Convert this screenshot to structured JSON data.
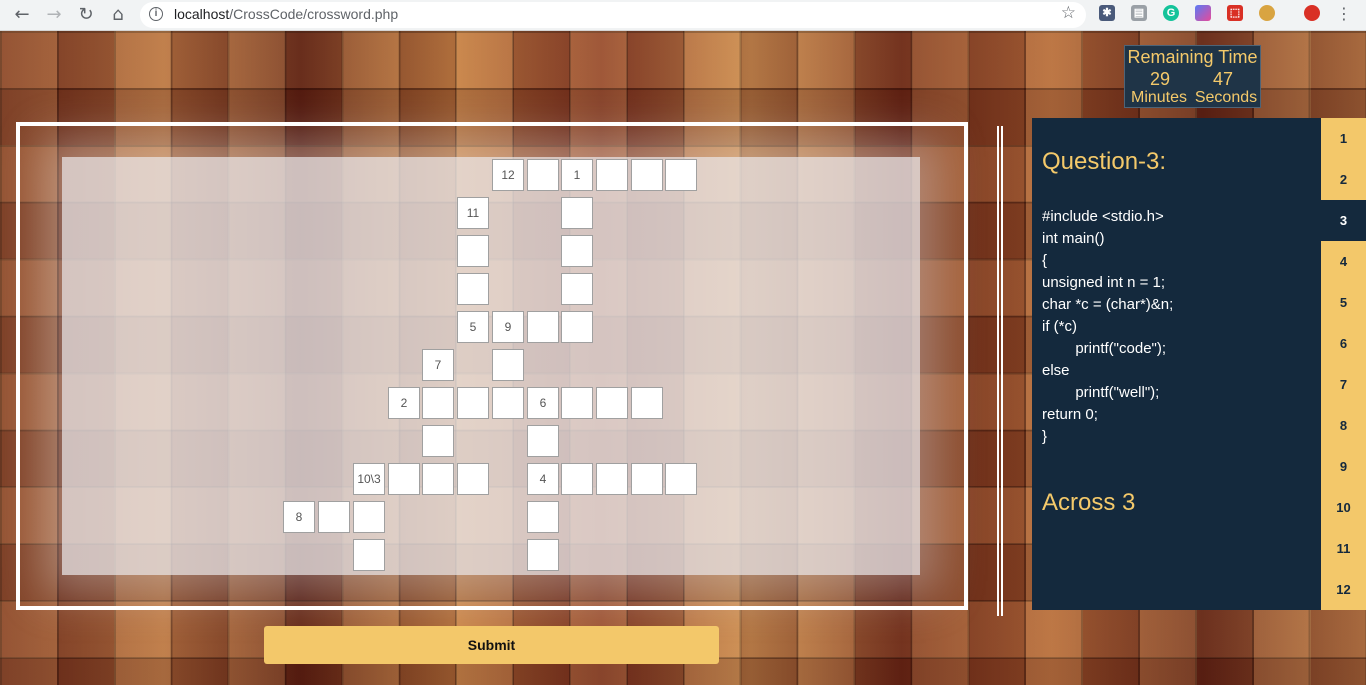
{
  "browser": {
    "url_host": "localhost",
    "url_path": "/CrossCode/crossword.php"
  },
  "timer": {
    "title": "Remaining Time",
    "minutes": "29",
    "minutes_label": "Minutes",
    "seconds": "47",
    "seconds_label": "Seconds"
  },
  "crossword": {
    "numbered_cells": [
      {
        "label": "12"
      },
      {
        "label": "1"
      },
      {
        "label": "11"
      },
      {
        "label": "5"
      },
      {
        "label": "9"
      },
      {
        "label": "7"
      },
      {
        "label": "2"
      },
      {
        "label": "6"
      },
      {
        "label": "10\\3"
      },
      {
        "label": "4"
      },
      {
        "label": "8"
      }
    ]
  },
  "question": {
    "title": "Question-3:",
    "code_lines": [
      "#include <stdio.h>",
      "int main()",
      "{",
      "unsigned int n = 1;",
      "char *c = (char*)&n;",
      "if (*c)",
      "        printf(\"code\");",
      "else",
      "        printf(\"well\");",
      "return 0;",
      "}"
    ],
    "direction": "Across 3"
  },
  "question_nav": [
    "1",
    "2",
    "3",
    "4",
    "5",
    "6",
    "7",
    "8",
    "9",
    "10",
    "11",
    "12"
  ],
  "active_question": "3",
  "submit_label": "Submit"
}
